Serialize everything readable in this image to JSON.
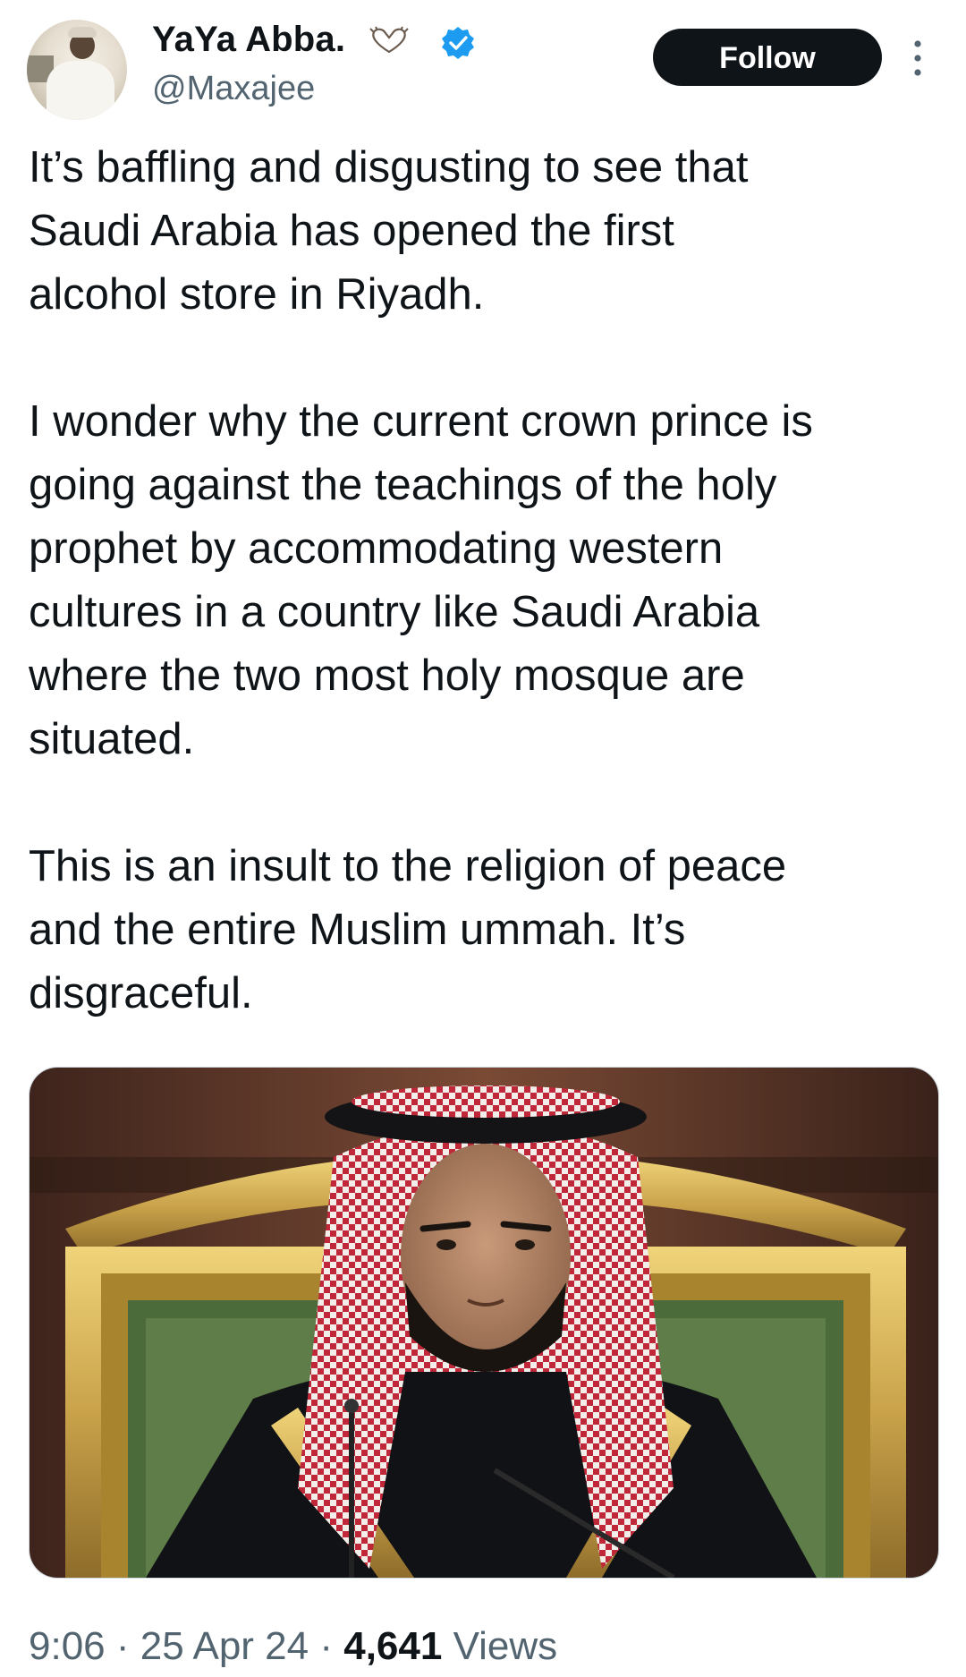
{
  "author": {
    "display_name": "YaYa Abba.",
    "handle": "@Maxajee",
    "name_emoji": "heart-hands-icon",
    "verified": true,
    "verified_color": "#1d9bf0"
  },
  "actions": {
    "follow_label": "Follow",
    "more_icon": "more-vertical-icon"
  },
  "tweet": {
    "text": "It’s baffling and disgusting to see that\nSaudi Arabia has opened the first\nalcohol store in Riyadh.\n\nI wonder why the current crown prince is\ngoing against the teachings of the holy\nprophet by accommodating western\ncultures in a country like Saudi Arabia\nwhere the two most holy mosque are\nsituated.\n\nThis is an insult to the religion of peace\nand the entire Muslim ummah. It’s\ndisgraceful."
  },
  "meta": {
    "time": "9:06",
    "separator": " · ",
    "date": "25 Apr 24",
    "views_count": "4,641",
    "views_label": " Views"
  },
  "colors": {
    "text_primary": "#0f1419",
    "text_secondary": "#536471",
    "button_bg": "#0f1419",
    "button_text": "#ffffff"
  }
}
